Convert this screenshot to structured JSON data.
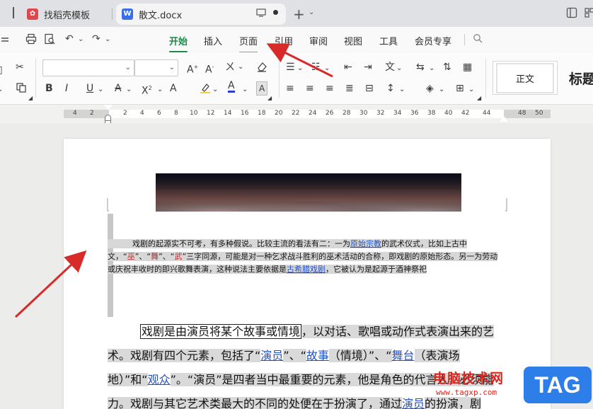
{
  "tabs": [
    {
      "label": "找稻壳模板",
      "icon": "wps-red-icon"
    },
    {
      "label": "散文.docx",
      "icon": "word-w-icon",
      "icon_text": "W"
    }
  ],
  "menu": {
    "items": [
      "开始",
      "插入",
      "页面",
      "引用",
      "审阅",
      "视图",
      "工具",
      "会员专享"
    ],
    "active": "开始"
  },
  "toolbar": {
    "font_name": "",
    "font_size": "",
    "style_normal": "正文",
    "style_heading": "标题"
  },
  "ruler": {
    "numbers": [
      "4",
      "2",
      "2",
      "4",
      "6",
      "8",
      "10",
      "12",
      "14",
      "16",
      "18",
      "20",
      "22",
      "24",
      "26",
      "28",
      "30",
      "32",
      "34",
      "36",
      "38",
      "40",
      "42",
      "44",
      "48",
      "50"
    ]
  },
  "document": {
    "para1": {
      "t1": "戏剧的起源实不可考，有多种假说。比较主流的看法有二：一为",
      "link1": "原始宗教",
      "t2": "的武术仪式，比如上古中文，“",
      "r1": "巫",
      "t3": "”、“",
      "r2": "舞",
      "t4": "”、“",
      "r3": "武",
      "t5": "”三字同源，可能是对一种乞求战斗胜利的巫术活动的合称，即戏剧的原始形态。另一为劳动或庆祝丰收时的即兴歌舞表演，这种说法主要依据是",
      "link2": "古希腊戏剧",
      "t6": "，它被认为是起源于酒神祭祀"
    },
    "para2": {
      "boxed": "戏剧是由演员将某个故事或情境",
      "t1": "，以对话、歌唱或动作式表演出来的艺术。戏剧有四个元素，包括了“",
      "l1": "演员",
      "t2": "”、“",
      "l2": "故事",
      "t3": "（情境）”、“",
      "l3": "舞台",
      "t4": "（表演场地）”和“",
      "l4": "观众",
      "t5": "”。“演员”是四者当中最重要的元素，他是角色的代言人，必须",
      "t6": "能力。戏剧与其它艺术类最大的不同的处便在于扮演了，通过",
      "l5": "演员",
      "t7": "的扮演，剧"
    }
  },
  "watermark": {
    "title": "电脑技术网",
    "url": "www.tagxp.com",
    "tag": "TAG"
  },
  "colors": {
    "accent": "#1f8a4a",
    "arrow": "#d92a2a",
    "link": "#2352c7"
  }
}
